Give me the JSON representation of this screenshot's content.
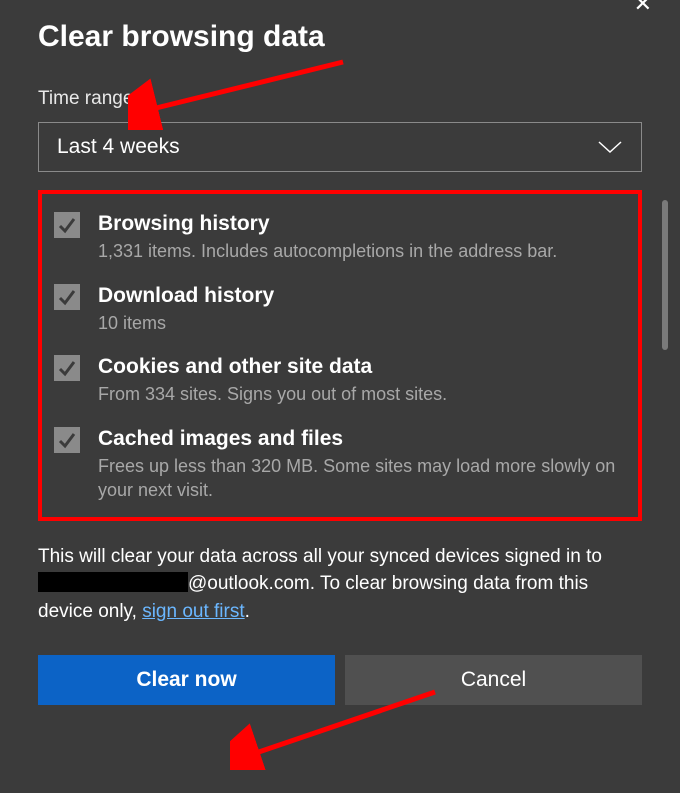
{
  "dialog": {
    "title": "Clear browsing data",
    "time_range_label": "Time range",
    "time_range_value": "Last 4 weeks"
  },
  "options": [
    {
      "title": "Browsing history",
      "desc": "1,331 items. Includes autocompletions in the address bar."
    },
    {
      "title": "Download history",
      "desc": "10 items"
    },
    {
      "title": "Cookies and other site data",
      "desc": "From 334 sites. Signs you out of most sites."
    },
    {
      "title": "Cached images and files",
      "desc": "Frees up less than 320 MB. Some sites may load more slowly on your next visit."
    }
  ],
  "footer": {
    "pre": "This will clear your data across all your synced devices signed in to ",
    "email_suffix": "@outlook.com",
    "mid": ". To clear browsing data from this device only, ",
    "link": "sign out first",
    "post": "."
  },
  "buttons": {
    "primary": "Clear now",
    "secondary": "Cancel"
  }
}
